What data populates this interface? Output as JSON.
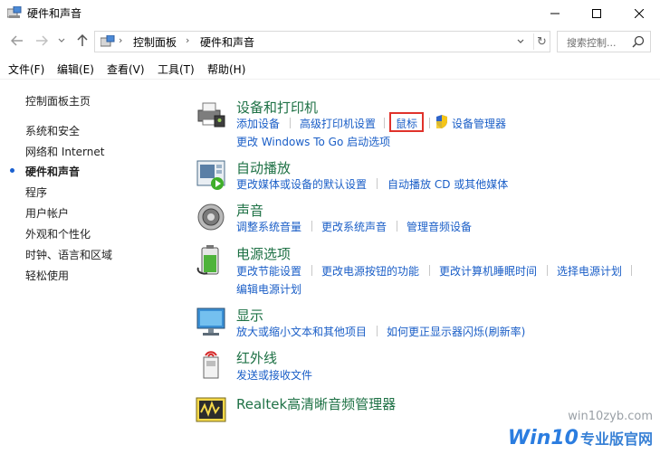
{
  "window": {
    "title": "硬件和声音",
    "buttons": {
      "minimize": "minimize-icon",
      "maximize": "maximize-icon",
      "close": "close-icon"
    }
  },
  "address_bar": {
    "crumbs": [
      "控制面板",
      "硬件和声音"
    ],
    "search_placeholder": "搜索控制..."
  },
  "menu": [
    "文件(F)",
    "编辑(E)",
    "查看(V)",
    "工具(T)",
    "帮助(H)"
  ],
  "sidebar": {
    "home": "控制面板主页",
    "items": [
      "系统和安全",
      "网络和 Internet",
      "硬件和声音",
      "程序",
      "用户帐户",
      "外观和个性化",
      "时钟、语言和区域",
      "轻松使用"
    ],
    "current_index": 2
  },
  "categories": [
    {
      "heading": "设备和打印机",
      "icon": "printer-icon",
      "links": [
        "添加设备",
        "高级打印机设置",
        "鼠标",
        "设备管理器",
        "更改 Windows To Go 启动选项"
      ]
    },
    {
      "heading": "自动播放",
      "icon": "autoplay-icon",
      "links": [
        "更改媒体或设备的默认设置",
        "自动播放 CD 或其他媒体"
      ]
    },
    {
      "heading": "声音",
      "icon": "speaker-icon",
      "links": [
        "调整系统音量",
        "更改系统声音",
        "管理音频设备"
      ]
    },
    {
      "heading": "电源选项",
      "icon": "battery-icon",
      "links": [
        "更改节能设置",
        "更改电源按钮的功能",
        "更改计算机睡眠时间",
        "选择电源计划",
        "编辑电源计划"
      ]
    },
    {
      "heading": "显示",
      "icon": "monitor-icon",
      "links": [
        "放大或缩小文本和其他项目",
        "如何更正显示器闪烁(刷新率)"
      ]
    },
    {
      "heading": "红外线",
      "icon": "infrared-icon",
      "links": [
        "发送或接收文件"
      ]
    },
    {
      "heading": "Realtek高清晰音频管理器",
      "icon": "realtek-audio-icon",
      "links": []
    }
  ],
  "highlight_color": "#e0322b",
  "link_color": "#1a5ec7",
  "heading_color": "#1e7145",
  "watermark": {
    "url": "win10zyb.com",
    "brand_main": "Win10",
    "brand_sub": "专业版官网"
  }
}
